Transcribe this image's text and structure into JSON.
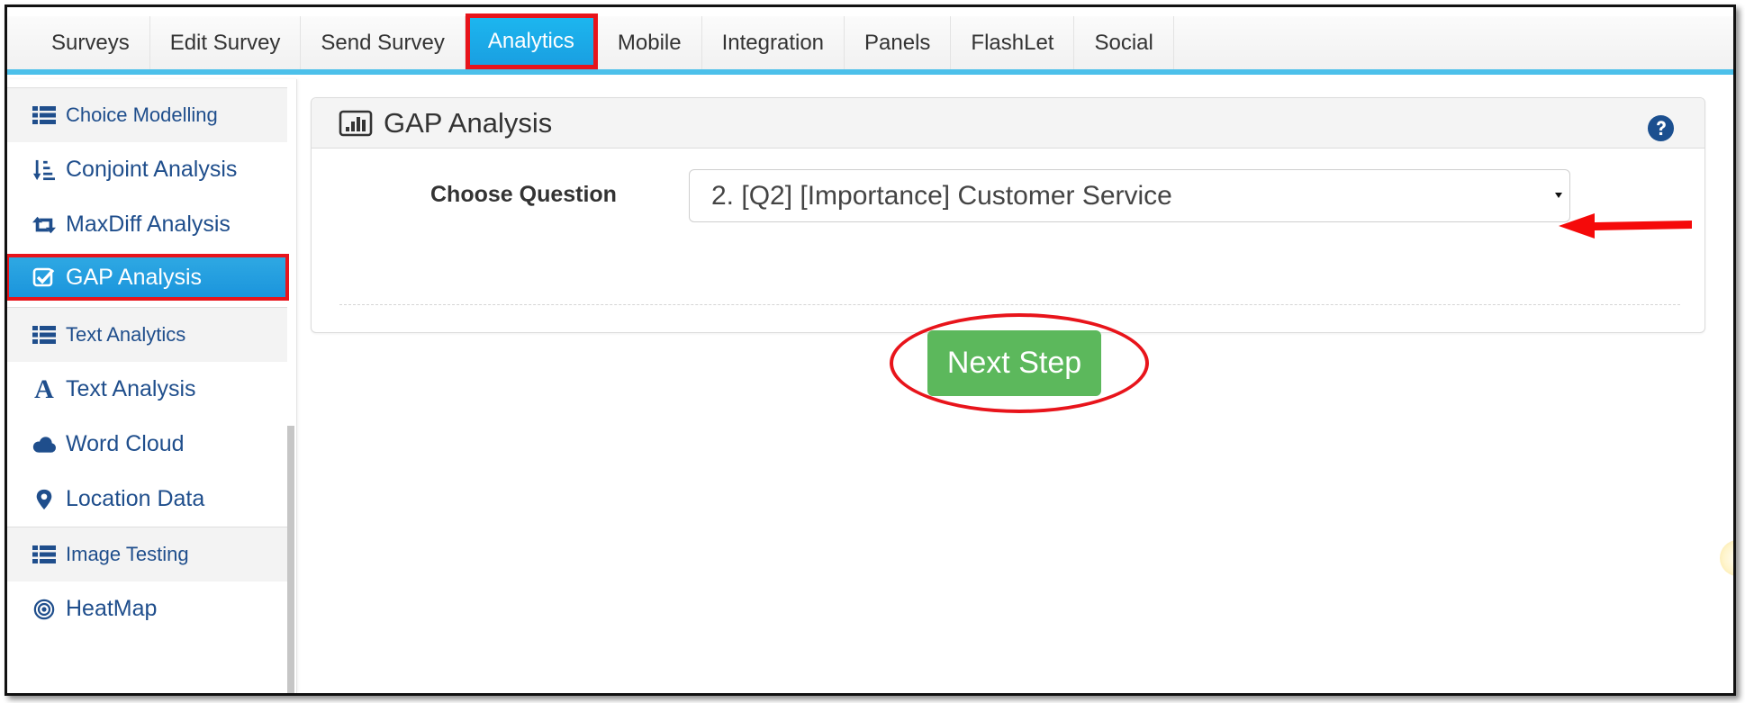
{
  "tabs": [
    {
      "label": "Surveys",
      "active": false
    },
    {
      "label": "Edit Survey",
      "active": false
    },
    {
      "label": "Send Survey",
      "active": false
    },
    {
      "label": "Analytics",
      "active": true
    },
    {
      "label": "Mobile",
      "active": false
    },
    {
      "label": "Integration",
      "active": false
    },
    {
      "label": "Panels",
      "active": false
    },
    {
      "label": "FlashLet",
      "active": false
    },
    {
      "label": "Social",
      "active": false
    }
  ],
  "sidebar": {
    "sections": {
      "choice_modelling": {
        "label": "Choice Modelling",
        "icon": "list-icon"
      },
      "text_analytics": {
        "label": "Text Analytics",
        "icon": "list-icon"
      },
      "image_testing": {
        "label": "Image Testing",
        "icon": "list-icon"
      }
    },
    "items": {
      "conjoint": {
        "label": "Conjoint Analysis",
        "icon": "sort-amount-icon"
      },
      "maxdiff": {
        "label": "MaxDiff Analysis",
        "icon": "retweet-icon"
      },
      "gap": {
        "label": "GAP Analysis",
        "icon": "checkbox-icon",
        "active": true
      },
      "text_analysis": {
        "label": "Text Analysis",
        "icon": "font-icon"
      },
      "word_cloud": {
        "label": "Word Cloud",
        "icon": "cloud-icon"
      },
      "location_data": {
        "label": "Location Data",
        "icon": "map-marker-icon"
      },
      "heatmap": {
        "label": "HeatMap",
        "icon": "bullseye-icon"
      }
    }
  },
  "panel": {
    "title": "GAP Analysis",
    "title_icon": "bar-chart-icon",
    "help_icon": "question-circle-icon",
    "choose_question_label": "Choose Question",
    "selected_question": "2. [Q2] [Importance] Customer Service",
    "next_button": "Next Step"
  },
  "colors": {
    "accent_blue": "#1a9de0",
    "tab_underline": "#4cc0ea",
    "nav_text": "#1f4e8c",
    "success_green": "#5cb85c",
    "annotation_red": "#e8141b"
  }
}
